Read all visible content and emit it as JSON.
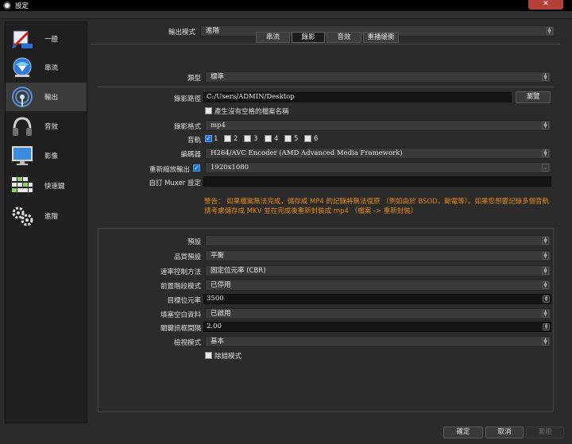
{
  "window": {
    "title": "設定",
    "close_glyph": "✕"
  },
  "sidebar": {
    "items": [
      {
        "label": "一般",
        "icon": "general-icon",
        "active": false
      },
      {
        "label": "串流",
        "icon": "stream-globe-icon",
        "active": false
      },
      {
        "label": "輸出",
        "icon": "output-antenna-icon",
        "active": true
      },
      {
        "label": "音效",
        "icon": "audio-headphones-icon",
        "active": false
      },
      {
        "label": "影像",
        "icon": "video-monitor-icon",
        "active": false
      },
      {
        "label": "快速鍵",
        "icon": "keyboard-icon",
        "active": false
      },
      {
        "label": "進階",
        "icon": "advanced-gears-icon",
        "active": false
      }
    ]
  },
  "output_mode": {
    "label": "輸出模式",
    "value": "進階"
  },
  "tabs": [
    {
      "label": "串流",
      "active": false
    },
    {
      "label": "錄影",
      "active": true
    },
    {
      "label": "音效",
      "active": false
    },
    {
      "label": "重播緩衝",
      "active": false
    }
  ],
  "recording": {
    "type": {
      "label": "類型",
      "value": "標準"
    },
    "path": {
      "label": "錄影路徑",
      "value": "C:/Users/ADMIN/Desktop",
      "browse": "瀏覽"
    },
    "no_space": {
      "label": "產生沒有空格的檔案名稱",
      "checked": false
    },
    "format": {
      "label": "錄影格式",
      "value": "mp4"
    },
    "tracks": {
      "label": "音軌",
      "items": [
        {
          "label": "1",
          "checked": true
        },
        {
          "label": "2",
          "checked": false
        },
        {
          "label": "3",
          "checked": false
        },
        {
          "label": "4",
          "checked": false
        },
        {
          "label": "5",
          "checked": false
        },
        {
          "label": "6",
          "checked": false
        }
      ]
    },
    "encoder": {
      "label": "編碼器",
      "value": "H264/AVC Encoder (AMD Advanced Media Framework)"
    },
    "rescale": {
      "label": "重新縮放輸出",
      "checked": true,
      "value": "1920x1080"
    },
    "muxer": {
      "label": "自訂 Muxer 設定",
      "value": ""
    },
    "warning": "警告： 如果檔案無法完成，儲存成 MP4 的記錄將無法復原 （例如由於 BSOD，斷電等）。如果您想要記錄多個音軌請考慮儲存成 MKV 並在完成後重新封裝成 mp4 （檔案 -> 重新封裝）"
  },
  "encoder_settings": {
    "preset": {
      "label": "預設",
      "value": ""
    },
    "quality_preset": {
      "label": "品質預設",
      "value": "平衡"
    },
    "rate_control": {
      "label": "速率控制方法",
      "value": "固定位元率 (CBR)"
    },
    "pre_pass": {
      "label": "前置階段模式",
      "value": "已停用"
    },
    "target_bitrate": {
      "label": "目標位元率",
      "value": "3500"
    },
    "filler_data": {
      "label": "填塞空白資料",
      "value": "已啟用"
    },
    "keyframe_interval": {
      "label": "關鍵訊框間隔",
      "value": "2.00"
    },
    "view_mode": {
      "label": "檢視模式",
      "value": "基本"
    },
    "debug_mode": {
      "label": "除錯模式",
      "checked": false
    }
  },
  "buttons": {
    "ok": "確定",
    "cancel": "取消",
    "apply": "套用"
  },
  "colors": {
    "warning": "#e38a17",
    "checkbox_on": "#1e6fd1",
    "close": "#b4403a"
  }
}
